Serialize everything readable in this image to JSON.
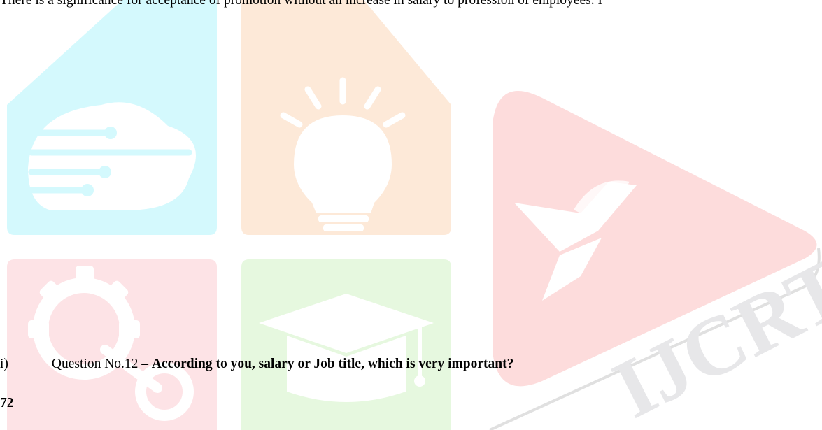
{
  "document": {
    "top_line": "There is a significance for acceptance of promotion without an increase in salary to profession of employees.  I",
    "question": {
      "marker": "i)",
      "number": "Question No.12 – ",
      "text": "According to you, salary or Job title, which is very important?"
    },
    "page_number": "72"
  },
  "watermark": {
    "logo_text": "IJCRT",
    "colors": {
      "cyan_tile": "#d4f9fd",
      "orange_tile": "#fde9d8",
      "red_tile": "#fddcdc",
      "pink_tile": "#fde3e6",
      "green_tile": "#e6f8df",
      "letters": "#e6e6e8"
    },
    "icons": [
      "cloud-network-icon",
      "lightbulb-icon",
      "book-icon",
      "gear-icon",
      "graduation-cap-icon"
    ]
  }
}
